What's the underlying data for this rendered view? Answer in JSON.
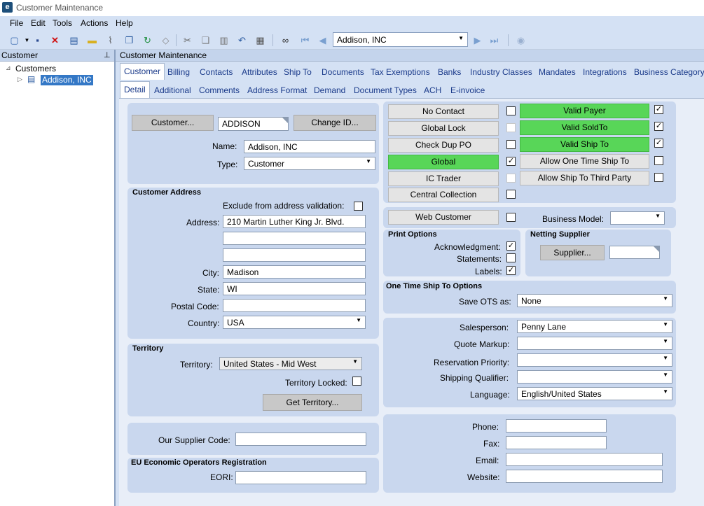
{
  "window": {
    "title": "Customer Maintenance",
    "logo": "e"
  },
  "menu": {
    "file": "File",
    "edit": "Edit",
    "tools": "Tools",
    "actions": "Actions",
    "help": "Help"
  },
  "toolbar": {
    "record_value": "Addison, INC"
  },
  "left_pane": {
    "title": "Customer",
    "tree_root": "Customers",
    "tree_item": "Addison, INC"
  },
  "right_pane": {
    "title": "Customer Maintenance"
  },
  "tabs_row1": [
    "Customer",
    "Billing",
    "Contacts",
    "Attributes",
    "Ship To",
    "Documents",
    "Tax Exemptions",
    "Banks",
    "Industry Classes",
    "Mandates",
    "Integrations",
    "Business Category"
  ],
  "tabs_row2": [
    "Detail",
    "Additional",
    "Comments",
    "Address Format",
    "Demand",
    "Document Types",
    "ACH",
    "E-invoice"
  ],
  "header": {
    "customer_button": "Customer...",
    "customer_id": "ADDISON",
    "change_id_button": "Change ID...",
    "name_label": "Name:",
    "name_value": "Addison, INC",
    "type_label": "Type:",
    "type_value": "Customer"
  },
  "address": {
    "title": "Customer Address",
    "exclude_label": "Exclude from address validation:",
    "address_label": "Address:",
    "address1": "210 Martin Luther King Jr. Blvd.",
    "address2": "",
    "address3": "",
    "city_label": "City:",
    "city": "Madison",
    "state_label": "State:",
    "state": "WI",
    "postal_label": "Postal Code:",
    "postal": "",
    "country_label": "Country:",
    "country": "USA"
  },
  "territory": {
    "title": "Territory",
    "territory_label": "Territory:",
    "territory_value": "United States - Mid West",
    "locked_label": "Territory Locked:",
    "get_button": "Get Territory..."
  },
  "supplier_code": {
    "label": "Our Supplier Code:",
    "value": ""
  },
  "eori": {
    "title": "EU Economic Operators Registration",
    "label": "EORI:",
    "value": ""
  },
  "flags": {
    "no_contact": "No Contact",
    "global_lock": "Global Lock",
    "check_dup_po": "Check Dup PO",
    "global": "Global",
    "ic_trader": "IC Trader",
    "central_collection": "Central Collection",
    "valid_payer": "Valid Payer",
    "valid_soldto": "Valid SoldTo",
    "valid_shipto": "Valid Ship To",
    "allow_ots": "Allow One Time Ship To",
    "allow_third_party": "Allow Ship To Third Party"
  },
  "web": {
    "web_customer": "Web Customer",
    "business_model_label": "Business Model:",
    "business_model_value": ""
  },
  "print_options": {
    "title": "Print Options",
    "ack_label": "Acknowledgment:",
    "statements_label": "Statements:",
    "labels_label": "Labels:"
  },
  "netting": {
    "title": "Netting Supplier",
    "supplier_button": "Supplier...",
    "supplier_value": ""
  },
  "ots": {
    "title": "One Time Ship To Options",
    "save_label": "Save OTS as:",
    "save_value": "None"
  },
  "sales": {
    "salesperson_label": "Salesperson:",
    "salesperson_value": "Penny Lane",
    "quote_markup_label": "Quote Markup:",
    "quote_markup_value": "",
    "reservation_label": "Reservation Priority:",
    "reservation_value": "",
    "shipping_label": "Shipping Qualifier:",
    "shipping_value": "",
    "language_label": "Language:",
    "language_value": "English/United States"
  },
  "contact": {
    "phone_label": "Phone:",
    "phone": "",
    "fax_label": "Fax:",
    "fax": "",
    "email_label": "Email:",
    "email": "",
    "website_label": "Website:",
    "website": ""
  },
  "icons": [
    "new-icon",
    "save-icon",
    "delete-icon",
    "book-icon",
    "folder-icon",
    "attach-icon",
    "copy-icon",
    "refresh-icon",
    "eraser-icon",
    "cut-icon",
    "paste-icon",
    "clipboard-icon",
    "undo-icon",
    "print-icon",
    "binoculars-icon",
    "first-record-icon",
    "previous-record-icon",
    "next-record-icon",
    "last-record-icon",
    "run-icon"
  ]
}
